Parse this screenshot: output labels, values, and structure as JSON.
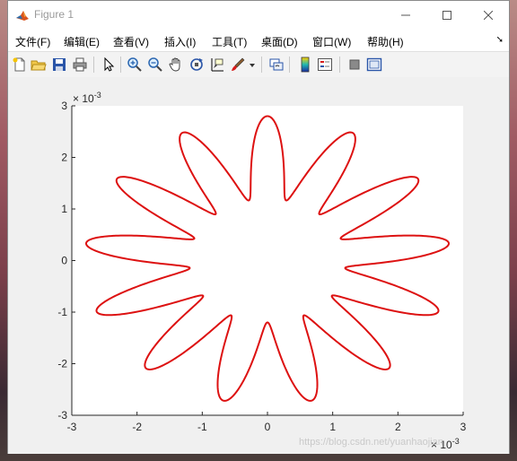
{
  "window": {
    "title": "Figure 1"
  },
  "menu": [
    {
      "label": "文件(F)"
    },
    {
      "label": "编辑(E)"
    },
    {
      "label": "查看(V)"
    },
    {
      "label": "插入(I)"
    },
    {
      "label": "工具(T)"
    },
    {
      "label": "桌面(D)"
    },
    {
      "label": "窗口(W)"
    },
    {
      "label": "帮助(H)"
    }
  ],
  "toolbar": {
    "icons": [
      "new-figure-icon",
      "open-file-icon",
      "save-icon",
      "print-icon",
      "select-arrow-icon",
      "zoom-in-icon",
      "zoom-out-icon",
      "pan-hand-icon",
      "rotate-3d-icon",
      "data-cursor-icon",
      "brush-icon",
      "link-plot-icon",
      "colorbar-icon",
      "legend-icon",
      "hide-plot-tools-icon",
      "show-plot-tools-icon"
    ]
  },
  "axes": {
    "exponent_label_y": "× 10",
    "exponent_power_y": "-3",
    "exponent_label_x": "× 10",
    "exponent_power_x": "-3",
    "xticks": [
      "-3",
      "-2",
      "-1",
      "0",
      "1",
      "2",
      "3"
    ],
    "yticks": [
      "3",
      "2",
      "1",
      "0",
      "-1",
      "-2",
      "-3"
    ]
  },
  "chart_data": {
    "type": "line",
    "xlim": [
      -0.003,
      0.003
    ],
    "ylim": [
      -0.003,
      0.003
    ],
    "grid": false,
    "series": [
      {
        "color": "#dd1111",
        "equation": "r(t) = 0.002 + 0.0008*sin(13 t), x = r cos t, y = r sin t",
        "t_range": [
          0,
          6.2832
        ]
      }
    ]
  },
  "watermark": {
    "text": "https://blog.csdn.net/yuanhaojian"
  }
}
